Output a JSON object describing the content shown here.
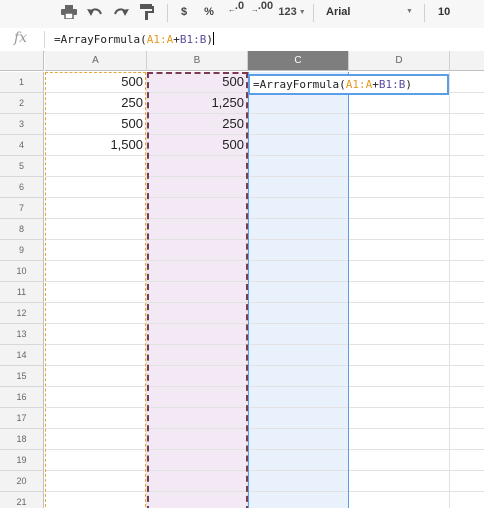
{
  "toolbar": {
    "buttons": [
      {
        "name": "print-icon"
      },
      {
        "name": "undo-icon"
      },
      {
        "name": "redo-icon"
      },
      {
        "name": "paint-format-icon"
      }
    ],
    "currency_label": "$",
    "percent_label": "%",
    "decrease_decimal_label": ".0",
    "increase_decimal_label": ".00",
    "more_formats_label": "123",
    "font_name": "Arial",
    "font_size": "10"
  },
  "formula_bar": {
    "fx_label": "fx",
    "formula_parts": [
      "=ArrayFormula(",
      "A1:A",
      "+",
      "B1:B",
      ")"
    ]
  },
  "columns": [
    "A",
    "B",
    "C",
    "D"
  ],
  "selected_column": "C",
  "rows": [
    "1",
    "2",
    "3",
    "4",
    "5",
    "6",
    "7",
    "8",
    "9",
    "10",
    "11",
    "12",
    "13",
    "14",
    "15",
    "16",
    "17",
    "18",
    "19",
    "20",
    "21"
  ],
  "cells": {
    "A": [
      "500",
      "250",
      "500",
      "1,500"
    ],
    "B": [
      "500",
      "1,250",
      "250",
      "500"
    ]
  },
  "editing_cell": {
    "formula_parts": [
      "=ArrayFormula(",
      "A1:A",
      "+",
      "B1:B",
      ")"
    ]
  },
  "colors": {
    "range_a": "#e6a83a",
    "range_b": "#7a3b50",
    "edit_border": "#5a9ee8",
    "col_b_fill": "#f3e9f5",
    "col_c_fill": "#e9f1fd"
  }
}
